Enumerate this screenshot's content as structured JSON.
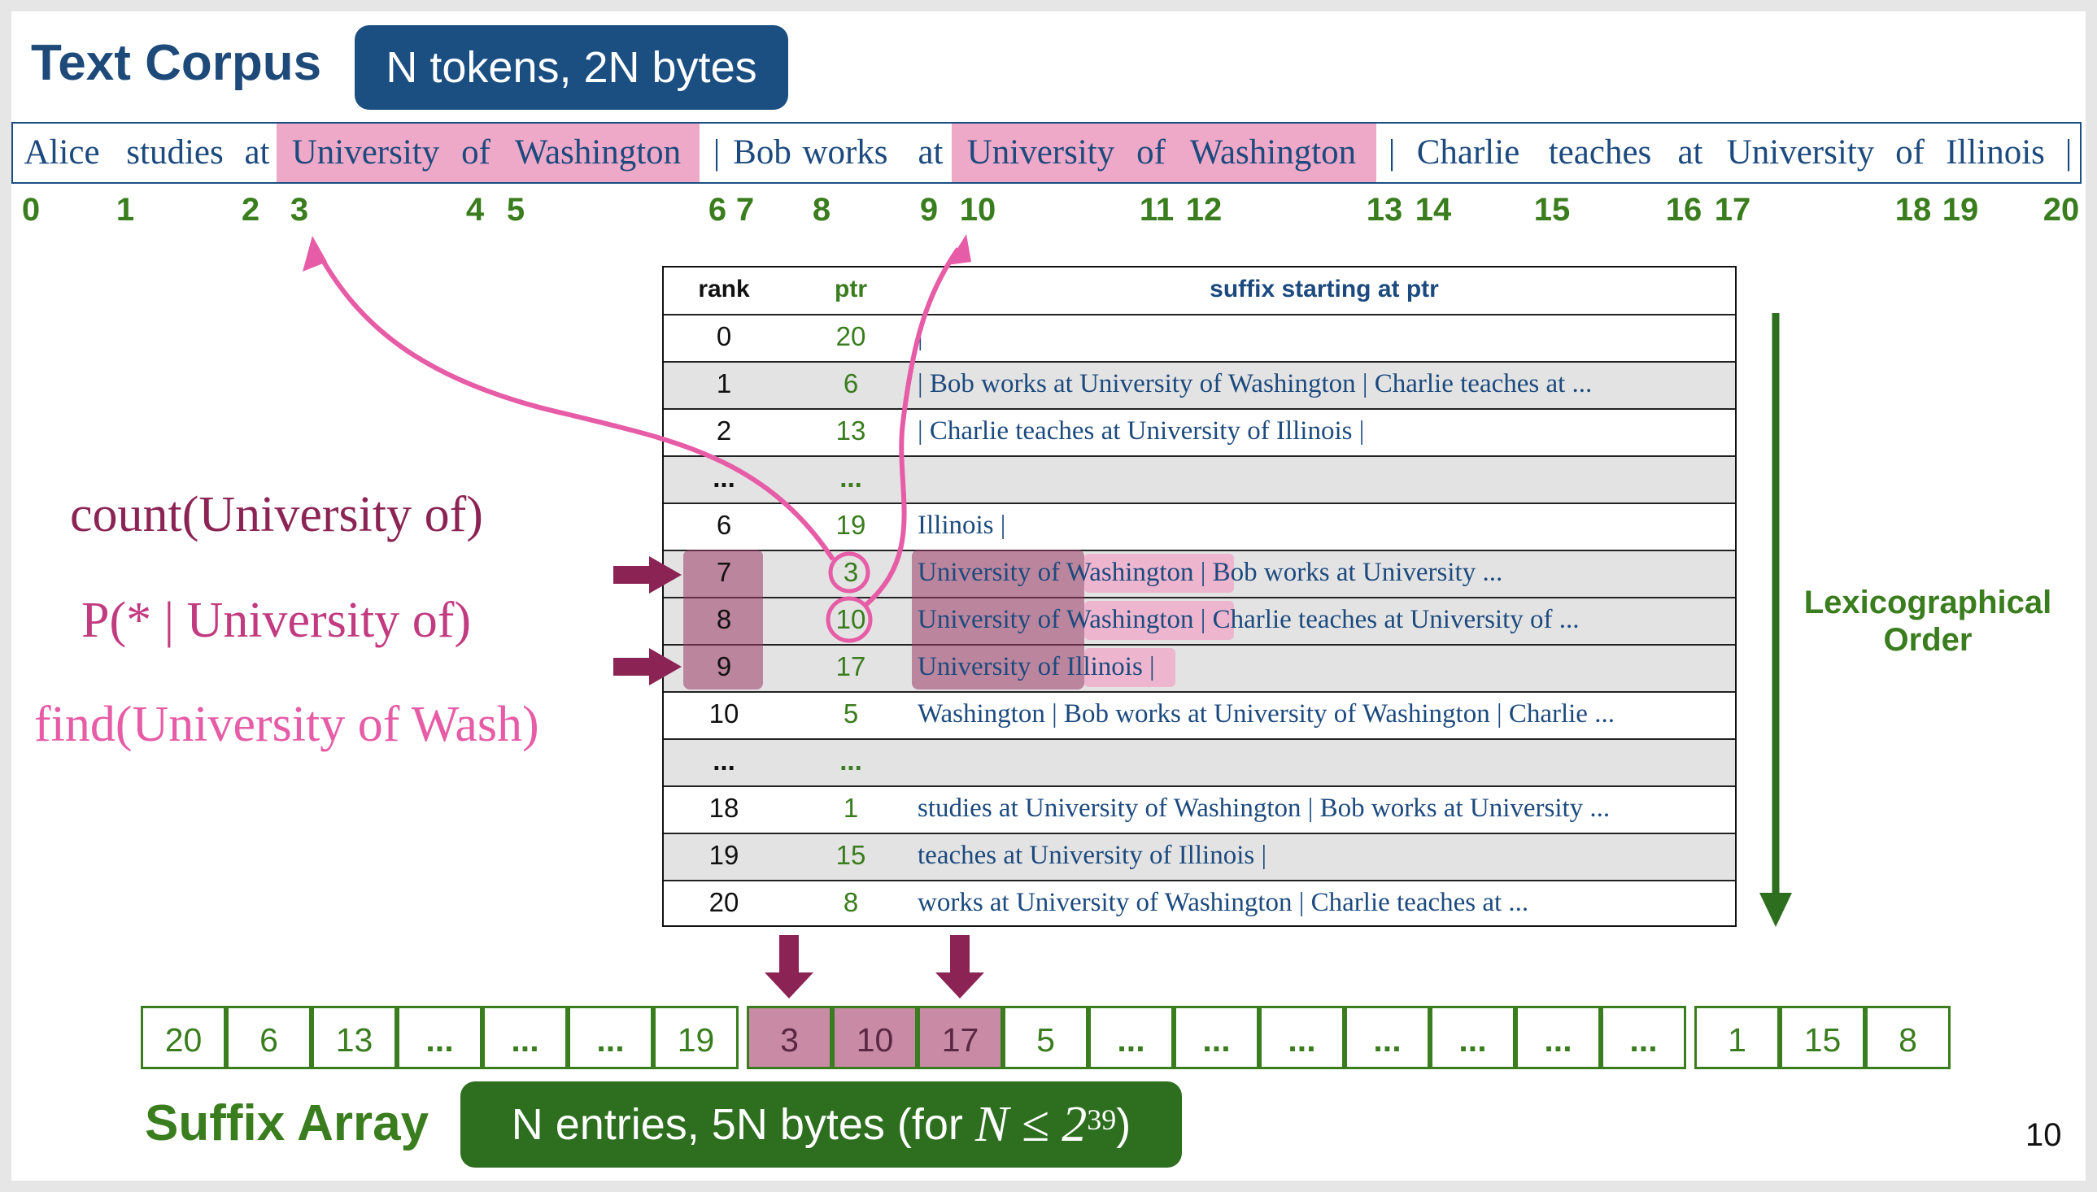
{
  "title": "Text Corpus",
  "corpus_badge": "N tokens, 2N bytes",
  "corpus_tokens": [
    "Alice",
    "studies",
    "at",
    "University",
    "of",
    "Washington",
    "|",
    "Bob",
    "works",
    "at",
    "University",
    "of",
    "Washington",
    "|",
    "Charlie",
    "teaches",
    "at",
    "University",
    "of",
    "Illinois",
    "|"
  ],
  "corpus_indices": [
    "0",
    "1",
    "2",
    "3",
    "4",
    "5",
    "6",
    "7",
    "8",
    "9",
    "10",
    "11",
    "12",
    "13",
    "14",
    "15",
    "16",
    "17",
    "18",
    "19",
    "20"
  ],
  "table": {
    "headers": {
      "rank": "rank",
      "ptr": "ptr",
      "suffix": "suffix starting at ptr"
    },
    "rows": [
      {
        "rank": "0",
        "ptr": "20",
        "suffix": "|"
      },
      {
        "rank": "1",
        "ptr": "6",
        "suffix": "| Bob works at University of Washington | Charlie teaches at ..."
      },
      {
        "rank": "2",
        "ptr": "13",
        "suffix": "| Charlie teaches at University of Illinois |"
      },
      {
        "rank": "...",
        "ptr": "...",
        "suffix": ""
      },
      {
        "rank": "6",
        "ptr": "19",
        "suffix": "Illinois |"
      },
      {
        "rank": "7",
        "ptr": "3",
        "suffix": "University of Washington | Bob works at University ..."
      },
      {
        "rank": "8",
        "ptr": "10",
        "suffix": "University of Washington | Charlie teaches at University of ..."
      },
      {
        "rank": "9",
        "ptr": "17",
        "suffix": "University of Illinois |"
      },
      {
        "rank": "10",
        "ptr": "5",
        "suffix": "Washington | Bob works at University of Washington | Charlie ..."
      },
      {
        "rank": "...",
        "ptr": "...",
        "suffix": ""
      },
      {
        "rank": "18",
        "ptr": "1",
        "suffix": "studies at University of Washington | Bob works at University ..."
      },
      {
        "rank": "19",
        "ptr": "15",
        "suffix": "teaches at University of Illinois |"
      },
      {
        "rank": "20",
        "ptr": "8",
        "suffix": "works at University of Washington | Charlie teaches at ..."
      }
    ]
  },
  "queries": {
    "count": "count(University of)",
    "prob": "P(* | University of)",
    "find": "find(University of Wash)"
  },
  "lex_label": {
    "line1": "Lexicographical",
    "line2": "Order"
  },
  "suffix_array": [
    "20",
    "6",
    "13",
    "...",
    "...",
    "...",
    "19",
    "3",
    "10",
    "17",
    "5",
    "...",
    "...",
    "...",
    "...",
    "...",
    "...",
    "...",
    "1",
    "15",
    "8"
  ],
  "suffix_array_title": "Suffix Array",
  "suffix_badge": {
    "text": "N entries, 5N bytes (for ",
    "math": "N ≤ 2",
    "exp": "39",
    "close": ")"
  },
  "page_number": "10",
  "colors": {
    "navy": "#1b4f82",
    "green": "#3a7d1e",
    "magenta": "#8b2454",
    "pink": "#e65ca6",
    "highlight": "#efa9c8"
  }
}
